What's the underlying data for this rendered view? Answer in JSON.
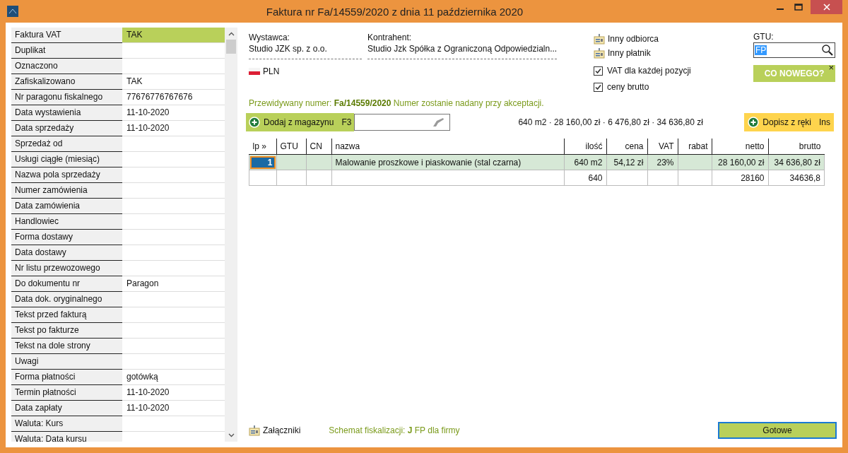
{
  "window": {
    "title": "Faktura nr Fa/14559/2020 z dnia 11 października 2020"
  },
  "properties": [
    {
      "label": "Faktura VAT",
      "value": "TAK",
      "selected": true
    },
    {
      "label": "Duplikat",
      "selected": false
    },
    {
      "label": "Oznaczono",
      "selected": false
    },
    {
      "label": "Zafiskalizowano",
      "value": "TAK",
      "selected": false
    },
    {
      "label": "Nr paragonu fiskalnego",
      "value": "77676776767676",
      "selected": false
    },
    {
      "label": "Data wystawienia",
      "value": "11-10-2020",
      "selected": false
    },
    {
      "label": "Data sprzedaży",
      "value": "11-10-2020",
      "selected": false
    },
    {
      "label": "Sprzedaż od",
      "selected": false
    },
    {
      "label": "Usługi ciągłe (miesiąc)",
      "selected": false
    },
    {
      "label": "Nazwa pola sprzedaży",
      "selected": false
    },
    {
      "label": "Numer zamówienia",
      "selected": false
    },
    {
      "label": "Data zamówienia",
      "selected": false
    },
    {
      "label": "Handlowiec",
      "selected": false
    },
    {
      "label": "Forma dostawy",
      "selected": false
    },
    {
      "label": "Data dostawy",
      "selected": false
    },
    {
      "label": "Nr listu przewozowego",
      "selected": false
    },
    {
      "label": "Do dokumentu nr",
      "value": "Paragon",
      "selected": false
    },
    {
      "label": "Data dok. oryginalnego",
      "selected": false
    },
    {
      "label": "Tekst przed fakturą",
      "selected": false
    },
    {
      "label": "Tekst po fakturze",
      "selected": false
    },
    {
      "label": "Tekst na dole strony",
      "selected": false
    },
    {
      "label": "Uwagi",
      "selected": false
    },
    {
      "label": "Forma płatności",
      "value": "gotówką",
      "selected": false
    },
    {
      "label": "Termin płatności",
      "value": "11-10-2020",
      "selected": false
    },
    {
      "label": "Data zapłaty",
      "value": "11-10-2020",
      "selected": false
    },
    {
      "label": "Waluta: Kurs",
      "selected": false
    },
    {
      "label": "Waluta: Data kursu",
      "selected": false
    }
  ],
  "issuer": {
    "label": "Wystawca:",
    "name": "Studio JZK sp. z o.o."
  },
  "counterparty": {
    "label": "Kontrahent:",
    "name": "Studio Jzk Spółka z Ograniczoną Odpowiedzialn..."
  },
  "currency": "PLN",
  "links": [
    "Inny odbiorca",
    "Inny płatnik"
  ],
  "options": [
    {
      "label": "VAT dla każdej pozycji",
      "checked": true
    },
    {
      "label": "ceny brutto",
      "checked": true
    }
  ],
  "gtu": {
    "label": "GTU:",
    "value": "FP"
  },
  "whats_new": {
    "label": "CO NOWEGO?",
    "close": "×"
  },
  "predicted_number": "Przewidywany numer: **Fa/14559/2020** Numer zostanie nadany przy akceptacji.",
  "add_from_stock": {
    "label": "Dodaj z magazynu",
    "shortcut": "F3"
  },
  "summary": "640 m2 · 28 160,00 zł · 6 476,80 zł · 34 636,80 zł",
  "add_manual": {
    "label": "Dopisz z ręki",
    "shortcut": "Ins"
  },
  "table": {
    "columns": [
      "lp »",
      "GTU",
      "CN",
      "nazwa",
      "ilość",
      "cena",
      "VAT",
      "rabat",
      "netto",
      "brutto"
    ],
    "rows": [
      {
        "selected": true,
        "cells": [
          "1",
          null,
          null,
          "Malowanie proszkowe i piaskowanie (stal czarna)",
          "640 m2",
          "54,12 zł",
          "23%",
          null,
          "28 160,00 zł",
          "34 636,80 zł"
        ]
      },
      {
        "selected": false,
        "cells": [
          null,
          null,
          null,
          null,
          "640",
          null,
          null,
          null,
          "28160",
          "34636,8"
        ]
      }
    ]
  },
  "attachments": "Załączniki",
  "fiscal_scheme": "Schemat fiskalizacji: **J** FP dla firmy",
  "done_button": "Gotowe"
}
